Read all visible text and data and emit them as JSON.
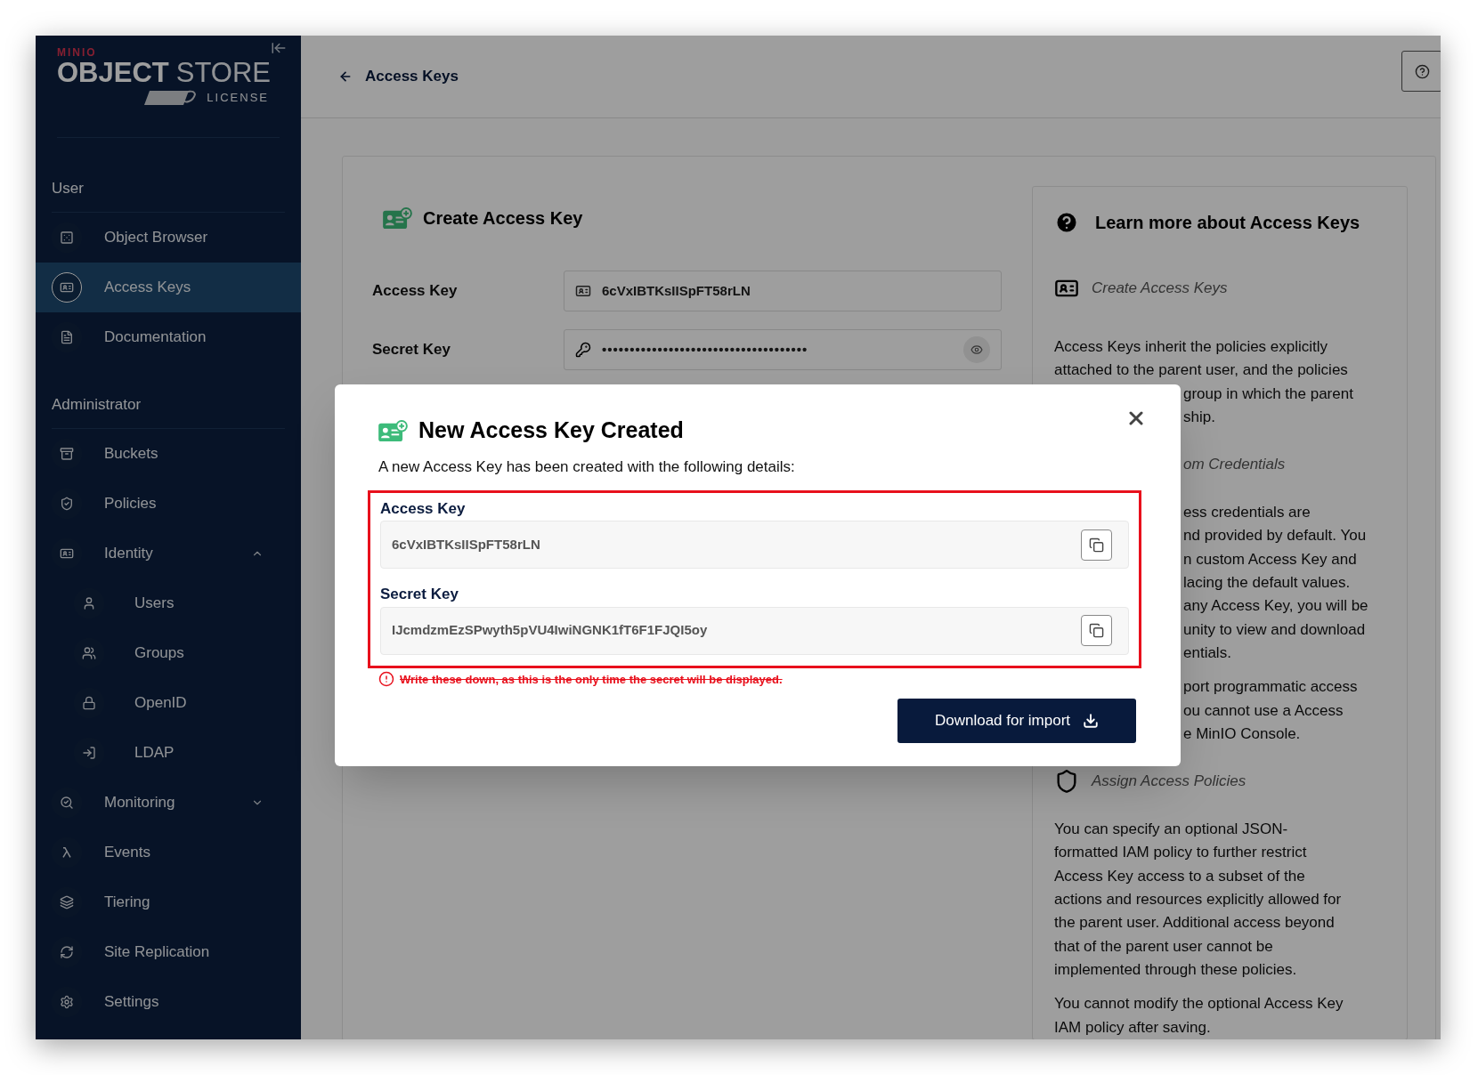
{
  "sidebar": {
    "logo": {
      "brand": "MINIO",
      "product_bold": "OBJECT",
      "product_light": "STORE",
      "license": "LICENSE"
    },
    "sections": [
      {
        "title": "User",
        "items": [
          {
            "label": "Object Browser",
            "selected": false
          },
          {
            "label": "Access Keys",
            "selected": true
          },
          {
            "label": "Documentation",
            "selected": false
          }
        ]
      },
      {
        "title": "Administrator",
        "items": [
          {
            "label": "Buckets",
            "selected": false
          },
          {
            "label": "Policies",
            "selected": false
          },
          {
            "label": "Identity",
            "selected": false,
            "expanded": true,
            "children": [
              {
                "label": "Users",
                "selected": false
              },
              {
                "label": "Groups",
                "selected": false
              },
              {
                "label": "OpenID",
                "selected": false
              },
              {
                "label": "LDAP",
                "selected": false
              }
            ]
          },
          {
            "label": "Monitoring",
            "selected": false,
            "expanded": false
          },
          {
            "label": "Events",
            "selected": false
          },
          {
            "label": "Tiering",
            "selected": false
          },
          {
            "label": "Site Replication",
            "selected": false
          },
          {
            "label": "Settings",
            "selected": false
          }
        ]
      }
    ]
  },
  "header": {
    "back_label": "Access Keys"
  },
  "form": {
    "title": "Create Access Key",
    "fields": [
      {
        "label": "Access Key",
        "value": "6cVxIBTKsIISpFT58rLN",
        "kind": "text"
      },
      {
        "label": "Secret Key",
        "value": "•••••••••••••••••••••••••••••••••••••",
        "kind": "password"
      }
    ]
  },
  "help_panel": {
    "title": "Learn more about Access Keys",
    "blocks": [
      {
        "kind": "heading",
        "text": "Create Access Keys",
        "covered": false
      },
      {
        "kind": "paragraph",
        "lines": [
          "Access Keys inherit the policies explicitly",
          "attached to the parent user, and the policies"
        ],
        "fragments": [
          "group in which the parent",
          "ship."
        ]
      },
      {
        "kind": "heading",
        "text": "om Credentials",
        "covered": true
      },
      {
        "kind": "paragraph",
        "fragments": [
          "ess credentials are",
          "nd provided by default. You",
          "n custom Access Key and",
          "lacing the default values.",
          "any Access Key, you will be",
          "unity to view and download",
          "entials."
        ]
      },
      {
        "kind": "paragraph",
        "fragments": [
          "port programmatic access",
          "ou cannot use a Access",
          "e MinIO Console."
        ]
      },
      {
        "kind": "heading",
        "text": "Assign Access Policies",
        "covered": false
      },
      {
        "kind": "paragraph",
        "lines": [
          "You can specify an optional JSON-",
          "formatted IAM policy to further restrict",
          "Access Key access to a subset of the",
          "actions and resources explicitly allowed for",
          "the parent user. Additional access beyond",
          "that of the parent user cannot be",
          "implemented through these policies."
        ]
      },
      {
        "kind": "paragraph",
        "lines": [
          "You cannot modify the optional Access Key",
          "IAM policy after saving."
        ]
      }
    ]
  },
  "dialog": {
    "title": "New Access Key Created",
    "subtitle": "A new Access Key has been created with the following details:",
    "fields": [
      {
        "label": "Access Key",
        "value": "6cVxIBTKsIISpFT58rLN"
      },
      {
        "label": "Secret Key",
        "value": "IJcmdzmEzSPwyth5pVU4IwiNGNK1fT6F1FJQI5oy"
      }
    ],
    "warning": "Write these down, as this is the only time the secret will be displayed.",
    "button": "Download for import"
  }
}
